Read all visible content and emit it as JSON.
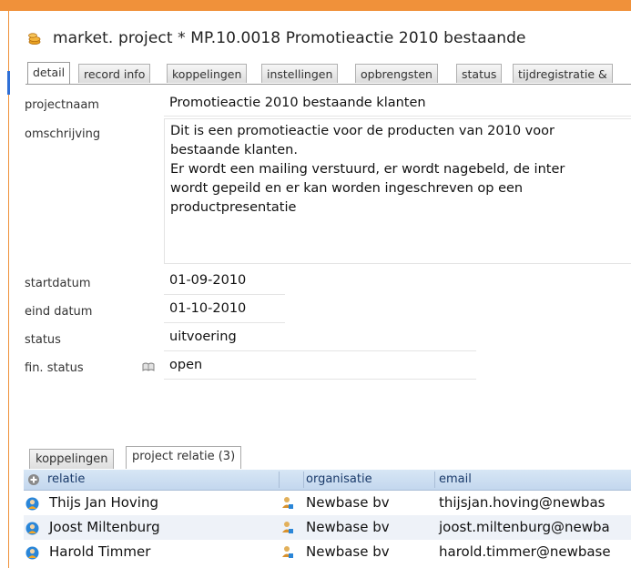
{
  "title": {
    "text": "market. project * MP.10.0018 Promotieactie 2010 bestaande"
  },
  "tabs": [
    {
      "label": "detail",
      "active": true
    },
    {
      "label": "record info"
    },
    {
      "label": "koppelingen"
    },
    {
      "label": "instellingen"
    },
    {
      "label": "opbrengsten"
    },
    {
      "label": "status"
    },
    {
      "label": "tijdregistratie &"
    }
  ],
  "form": {
    "projectnaam": {
      "label": "projectnaam",
      "value": "Promotieactie 2010 bestaande klanten"
    },
    "omschrijving": {
      "label": "omschrijving",
      "value": "Dit is een promotieactie voor de producten van 2010 voor\nbestaande klanten.\nEr wordt een mailing verstuurd, er wordt nagebeld, de inter\nwordt gepeild en er kan worden ingeschreven op een\nproductpresentatie"
    },
    "startdatum": {
      "label": "startdatum",
      "value": "01-09-2010"
    },
    "einddatum": {
      "label": "eind datum",
      "value": "01-10-2010"
    },
    "status": {
      "label": "status",
      "value": "uitvoering"
    },
    "finstatus": {
      "label": "fin. status",
      "value": "open"
    }
  },
  "lower_tabs": [
    {
      "label": "koppelingen"
    },
    {
      "label": "project relatie (3)",
      "active": true
    }
  ],
  "grid": {
    "columns": {
      "relatie": "relatie",
      "organisatie": "organisatie",
      "email": "email"
    },
    "rows": [
      {
        "relatie": "Thijs Jan Hoving",
        "organisatie": "Newbase bv",
        "email": "thijsjan.hoving@newbas"
      },
      {
        "relatie": "Joost Miltenburg",
        "organisatie": "Newbase bv",
        "email": "joost.miltenburg@newba"
      },
      {
        "relatie": "Harold Timmer",
        "organisatie": "Newbase bv",
        "email": "harold.timmer@newbase"
      }
    ]
  },
  "colors": {
    "accent_orange": "#f0913a",
    "header_blue": "#c3d7ee",
    "row_alt": "#eef2f8"
  },
  "icons": {
    "title": "project-coins-icon",
    "add": "add-circle-icon",
    "person": "person-globe-icon",
    "organisation": "organisation-user-icon",
    "lookup": "book-lookup-icon"
  }
}
